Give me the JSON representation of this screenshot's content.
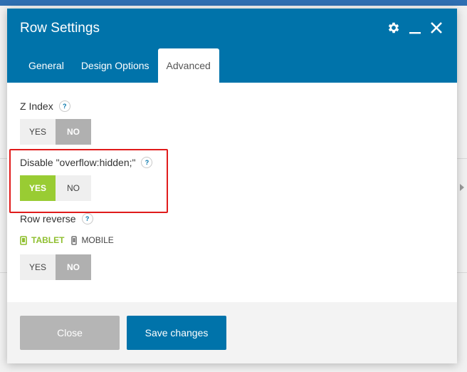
{
  "modal": {
    "title": "Row Settings",
    "colors": {
      "header": "#0073aa",
      "toggle_green": "#99cc33",
      "highlight": "#e01b1b"
    }
  },
  "header_icons": [
    "gear-icon",
    "minimize-icon",
    "close-icon"
  ],
  "tabs": [
    {
      "label": "General",
      "active": false
    },
    {
      "label": "Design Options",
      "active": false
    },
    {
      "label": "Advanced",
      "active": true
    }
  ],
  "fields": {
    "z_index": {
      "label": "Z Index",
      "help": "?",
      "yes": "YES",
      "no": "NO",
      "selected": "NO"
    },
    "overflow": {
      "label": "Disable \"overflow:hidden;\"",
      "help": "?",
      "yes": "YES",
      "no": "NO",
      "selected": "YES"
    },
    "row_reverse": {
      "label": "Row reverse",
      "help": "?",
      "devices": [
        {
          "label": "TABLET",
          "active": true
        },
        {
          "label": "MOBILE",
          "active": false
        }
      ],
      "yes": "YES",
      "no": "NO",
      "selected": "NO"
    }
  },
  "footer": {
    "close_label": "Close",
    "save_label": "Save changes"
  }
}
